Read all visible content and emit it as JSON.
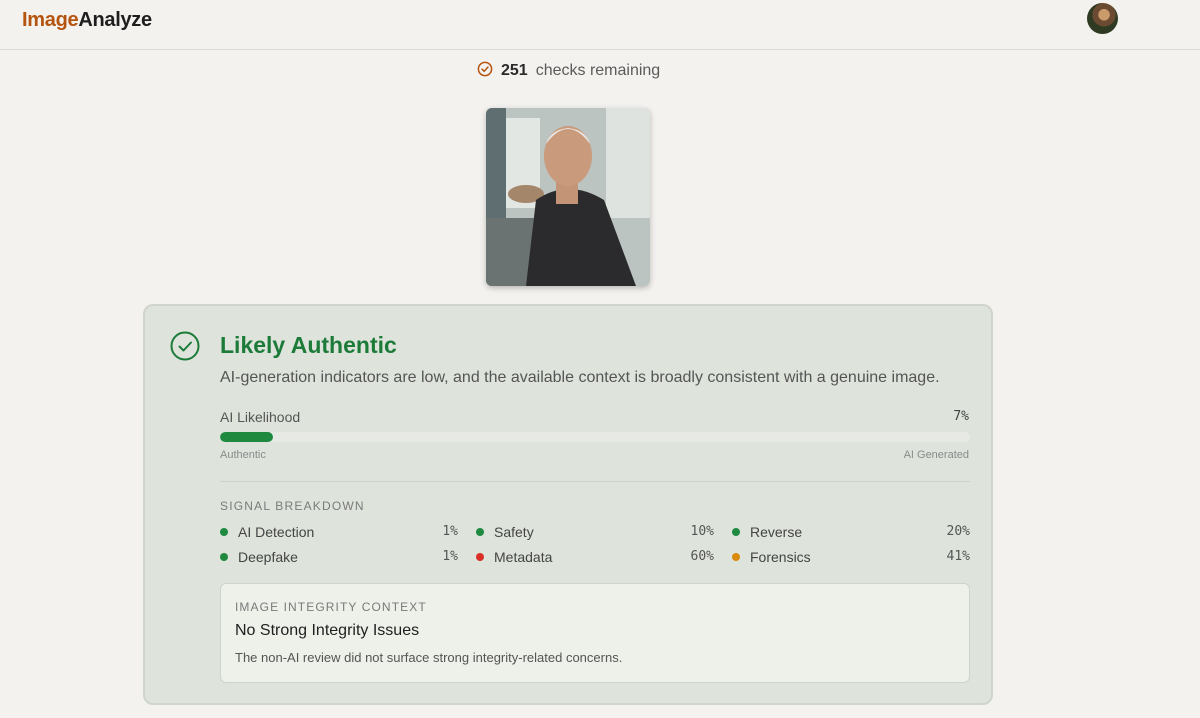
{
  "header": {
    "logo_part1": "Image",
    "logo_part2": "Analyze",
    "brand_color": "#b5540f"
  },
  "credits": {
    "count": "251",
    "label": "checks remaining",
    "icon": "check-circle-icon"
  },
  "result": {
    "verdict": "Likely Authentic",
    "verdict_color": "#1d7b3a",
    "summary": "AI-generation indicators are low, and the available context is broadly consistent with a genuine image.",
    "likelihood": {
      "label": "AI Likelihood",
      "value_text": "7%",
      "fraction": 0.07,
      "scale_left": "Authentic",
      "scale_right": "AI Generated"
    },
    "signal_breakdown": {
      "title": "SIGNAL BREAKDOWN",
      "items": [
        {
          "name": "AI Detection",
          "value": "1%",
          "color": "#1f8a3f"
        },
        {
          "name": "Safety",
          "value": "10%",
          "color": "#1f8a3f"
        },
        {
          "name": "Reverse",
          "value": "20%",
          "color": "#1f8a3f"
        },
        {
          "name": "Deepfake",
          "value": "1%",
          "color": "#1f8a3f"
        },
        {
          "name": "Metadata",
          "value": "60%",
          "color": "#d93025"
        },
        {
          "name": "Forensics",
          "value": "41%",
          "color": "#d98a0b"
        }
      ]
    },
    "integrity": {
      "title": "IMAGE INTEGRITY CONTEXT",
      "heading": "No Strong Integrity Issues",
      "body": "The non-AI review did not surface strong integrity-related concerns."
    }
  }
}
